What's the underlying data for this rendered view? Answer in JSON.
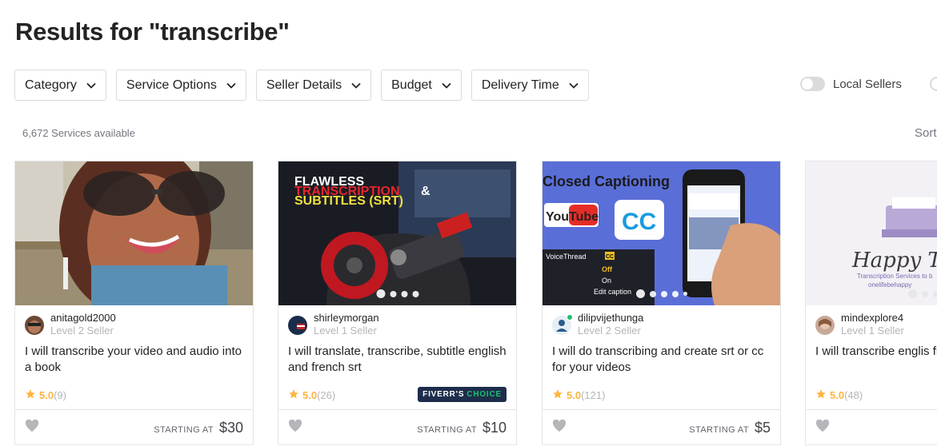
{
  "page": {
    "title": "Results for \"transcribe\""
  },
  "filters": [
    {
      "label": "Category"
    },
    {
      "label": "Service Options"
    },
    {
      "label": "Seller Details"
    },
    {
      "label": "Budget"
    },
    {
      "label": "Delivery Time"
    }
  ],
  "toggles": {
    "local_sellers": "Local Sellers"
  },
  "results": {
    "count_text": "6,672 Services available",
    "sort_label": "Sort"
  },
  "price_prefix": "STARTING AT",
  "badge": {
    "part1": "FIVERR'S",
    "part2": "CHOICE"
  },
  "thumbs": {
    "card2": {
      "line1": "FLAWLESS",
      "line2": "TRANSCRIPTION",
      "amp": "&",
      "line3": "SUBTITLES (SRT)"
    },
    "card3": {
      "heading": "Closed Captioning",
      "youtube": "YouTube",
      "cc": "CC",
      "panel_title": "VoiceThread",
      "panel_cc": "CC",
      "opt_off": "Off",
      "opt_on": "On",
      "edit": "Edit caption"
    },
    "card4": {
      "heading": "Happy Tra",
      "sub1": "Transcription Services to b",
      "sub2": "onelifebehappy"
    }
  },
  "cards": [
    {
      "seller": "anitagold2000",
      "level": "Level 2 Seller",
      "title": "I will transcribe your video and audio into a book",
      "score": "5.0",
      "reviews": "(9)",
      "price": "$30"
    },
    {
      "seller": "shirleymorgan",
      "level": "Level 1 Seller",
      "title": "I will translate, transcribe, subtitle english and french srt",
      "score": "5.0",
      "reviews": "(26)",
      "price": "$10"
    },
    {
      "seller": "dilipvijethunga",
      "level": "Level 2 Seller",
      "title": "I will do transcribing and create srt or cc for your videos",
      "score": "5.0",
      "reviews": "(121)",
      "price": "$5"
    },
    {
      "seller": "mindexplore4",
      "level": "Level 1 Seller",
      "title": "I will transcribe englis files to perfection",
      "score": "5.0",
      "reviews": "(48)",
      "price": ""
    }
  ],
  "colors": {
    "star": "#ffb33e",
    "badge_bg": "#1d2d4b",
    "badge_accent": "#1dbf73",
    "online": "#1dbf73"
  },
  "icons": {
    "chevron": "chevron-down-icon",
    "star": "star-icon",
    "heart": "heart-icon"
  }
}
